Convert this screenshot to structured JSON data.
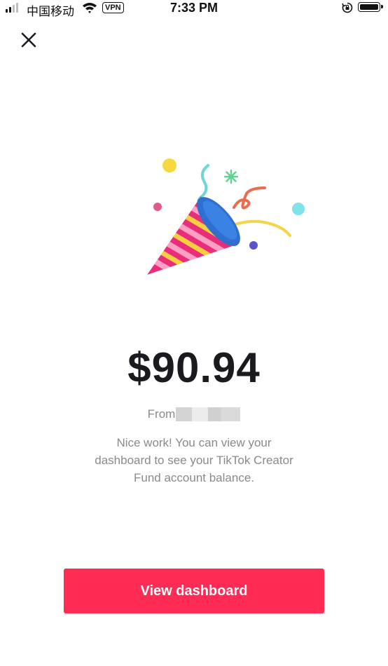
{
  "status_bar": {
    "carrier": "中国移动",
    "vpn_label": "VPN",
    "time": "7:33 PM",
    "signal_bars_filled": 2,
    "signal_bars_total": 4,
    "battery_level": 1.0
  },
  "icons": {
    "close": "close-icon",
    "illustration": "party-popper-icon"
  },
  "reward": {
    "amount": "$90.94",
    "from_label": "From",
    "message": "Nice work! You can view your dashboard to see your TikTok Creator Fund account balance."
  },
  "actions": {
    "view_dashboard_label": "View dashboard"
  },
  "colors": {
    "accent": "#fe2c55",
    "text_primary": "#1a1a1f",
    "text_secondary": "#8a8a8e"
  }
}
